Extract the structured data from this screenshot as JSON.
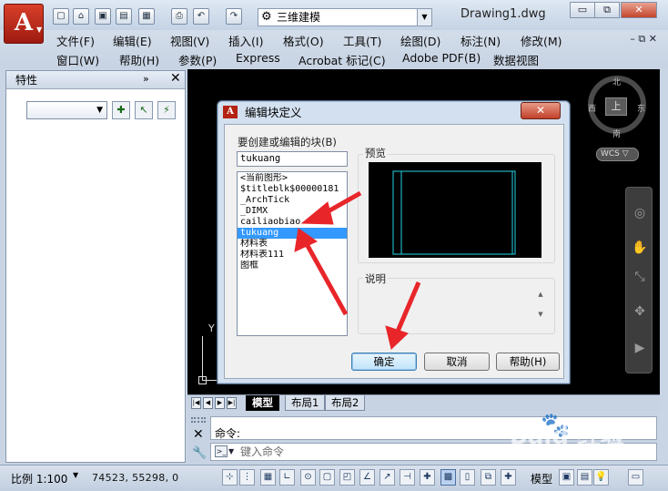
{
  "app": {
    "logo_letter": "A",
    "workspace": "三维建模",
    "document_title": "Drawing1.dwg",
    "window_controls": {
      "minimize": "▭",
      "restore": "⧉",
      "close": "✕"
    }
  },
  "menubar": {
    "row1": [
      "文件(F)",
      "编辑(E)",
      "视图(V)",
      "插入(I)",
      "格式(O)",
      "工具(T)",
      "绘图(D)",
      "标注(N)",
      "修改(M)"
    ],
    "row2": [
      "窗口(W)",
      "帮助(H)",
      "参数(P)",
      "Express",
      "Acrobat 标记(C)",
      "Adobe PDF(B)",
      "数据视图"
    ],
    "mdi_controls": "– ⧉ ✕"
  },
  "palette": {
    "title": "特性",
    "dock_icon": "»",
    "close": "✕",
    "selector_value": "▼"
  },
  "canvas": {
    "viewcube": {
      "face": "上",
      "north": "北",
      "south": "南",
      "east": "东",
      "west": "西",
      "wcs": "WCS ▽"
    },
    "ucs_y_label": "Y",
    "layout_tabs": [
      "模型",
      "布局1",
      "布局2"
    ],
    "tab_nav": [
      "|◀",
      "◀",
      "▶",
      "▶|"
    ]
  },
  "dialog": {
    "title": "编辑块定义",
    "close": "✕",
    "name_label": "要创建或编辑的块(B)",
    "name_value": "tukuang",
    "blocks": [
      "<当前图形>",
      "$titleblk$00000181",
      "_ArchTick",
      "_DIMX",
      "cailiaobiao",
      "tukuang",
      "材料表",
      "材料表111",
      "图框"
    ],
    "selected_index": 5,
    "preview_label": "预览",
    "description_label": "说明",
    "ok_label": "确定",
    "cancel_label": "取消",
    "help_label": "帮助(H)"
  },
  "command": {
    "history_text": "命令:",
    "input_placeholder": "键入命令",
    "prompt_icon": ">_"
  },
  "statusbar": {
    "scale": "比例 1:100",
    "coordinates": "74523,   55298,  0",
    "model_label": "模型"
  },
  "watermark": {
    "text": "Baid 经验"
  },
  "colors": {
    "accent_blue": "#3399ff",
    "arrow_red": "#e8262a",
    "canvas_bg": "#000000",
    "preview_lines": "#22d3e6"
  }
}
